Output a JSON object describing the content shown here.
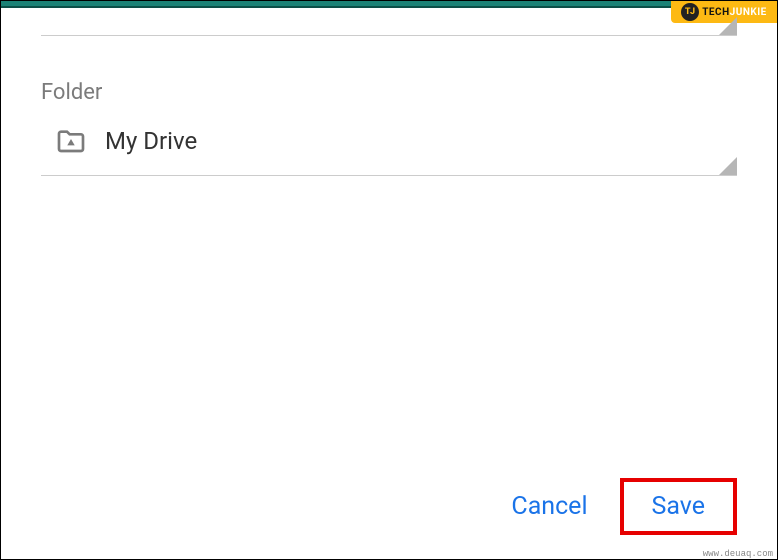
{
  "watermark": {
    "badge": "TJ",
    "brand_a": "TECH",
    "brand_b": "JUNKIE",
    "domain": "www.deuaq.com"
  },
  "folder": {
    "label": "Folder",
    "name": "My Drive"
  },
  "actions": {
    "cancel": "Cancel",
    "save": "Save"
  }
}
